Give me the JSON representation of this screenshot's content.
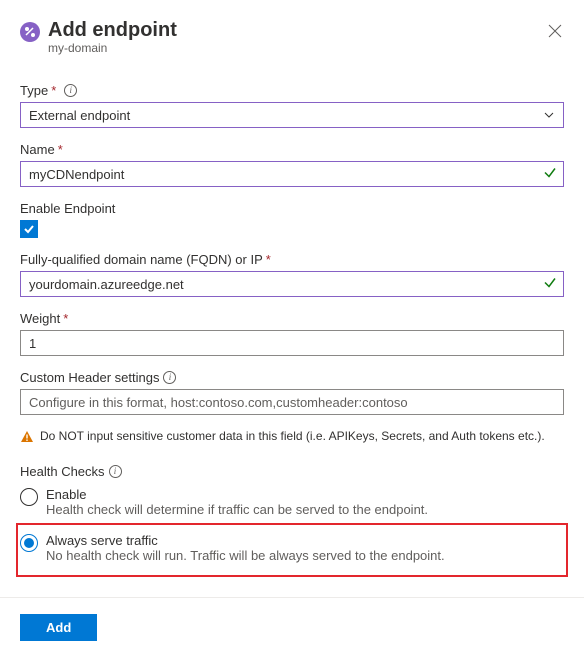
{
  "header": {
    "title": "Add endpoint",
    "subtitle": "my-domain"
  },
  "type_field": {
    "label": "Type",
    "value": "External endpoint"
  },
  "name_field": {
    "label": "Name",
    "value": "myCDNendpoint"
  },
  "enable_field": {
    "label": "Enable Endpoint",
    "checked": true
  },
  "fqdn_field": {
    "label": "Fully-qualified domain name (FQDN) or IP",
    "value": "yourdomain.azureedge.net"
  },
  "weight_field": {
    "label": "Weight",
    "value": "1"
  },
  "custom_header_field": {
    "label": "Custom Header settings",
    "placeholder": "Configure in this format, host:contoso.com,customheader:contoso"
  },
  "warning_text": "Do NOT input sensitive customer data in this field (i.e. APIKeys, Secrets, and Auth tokens etc.).",
  "health_checks": {
    "label": "Health Checks",
    "enable": {
      "label": "Enable",
      "sub": "Health check will determine if traffic can be served to the endpoint."
    },
    "always": {
      "label": "Always serve traffic",
      "sub": "No health check will run. Traffic will be always served to the endpoint."
    },
    "selected": "always"
  },
  "footer": {
    "add_label": "Add"
  }
}
